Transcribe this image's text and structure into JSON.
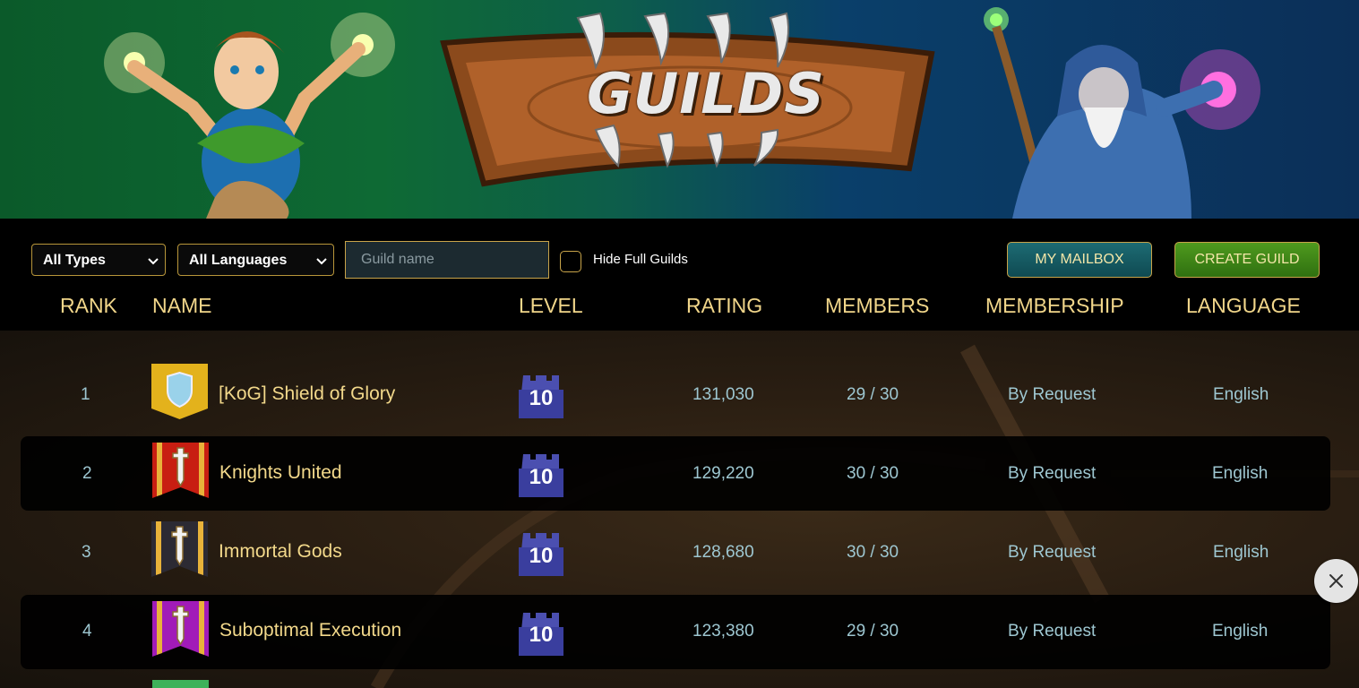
{
  "banner": {
    "title": "GUILDS"
  },
  "filters": {
    "type_select": "All Types",
    "language_select": "All Languages",
    "search_placeholder": "Guild name",
    "hide_full_label": "Hide Full Guilds"
  },
  "buttons": {
    "mailbox": "MY MAILBOX",
    "create_guild": "CREATE GUILD"
  },
  "columns": {
    "rank": "RANK",
    "name": "NAME",
    "level": "LEVEL",
    "rating": "RATING",
    "members": "MEMBERS",
    "membership": "MEMBERSHIP",
    "language": "LANGUAGE"
  },
  "guilds": [
    {
      "rank": "1",
      "name": "[KoG] Shield of Glory",
      "level": "10",
      "rating": "131,030",
      "members": "29 / 30",
      "membership": "By Request",
      "language": "English",
      "emblem": "shield-icon",
      "emblem_color": "#e3b21c"
    },
    {
      "rank": "2",
      "name": "Knights United",
      "level": "10",
      "rating": "129,220",
      "members": "30 / 30",
      "membership": "By Request",
      "language": "English",
      "emblem": "sword-icon",
      "emblem_color": "#c81e12"
    },
    {
      "rank": "3",
      "name": "Immortal Gods",
      "level": "10",
      "rating": "128,680",
      "members": "30 / 30",
      "membership": "By Request",
      "language": "English",
      "emblem": "sword-icon",
      "emblem_color": "#2c2a33"
    },
    {
      "rank": "4",
      "name": "Suboptimal Execution",
      "level": "10",
      "rating": "123,380",
      "members": "29 / 30",
      "membership": "By Request",
      "language": "English",
      "emblem": "sword-icon",
      "emblem_color": "#a11bb8"
    }
  ],
  "colors": {
    "accent_gold": "#f1d68a",
    "cell_text": "#9ec7d1",
    "border_gold": "#c8a44a"
  }
}
